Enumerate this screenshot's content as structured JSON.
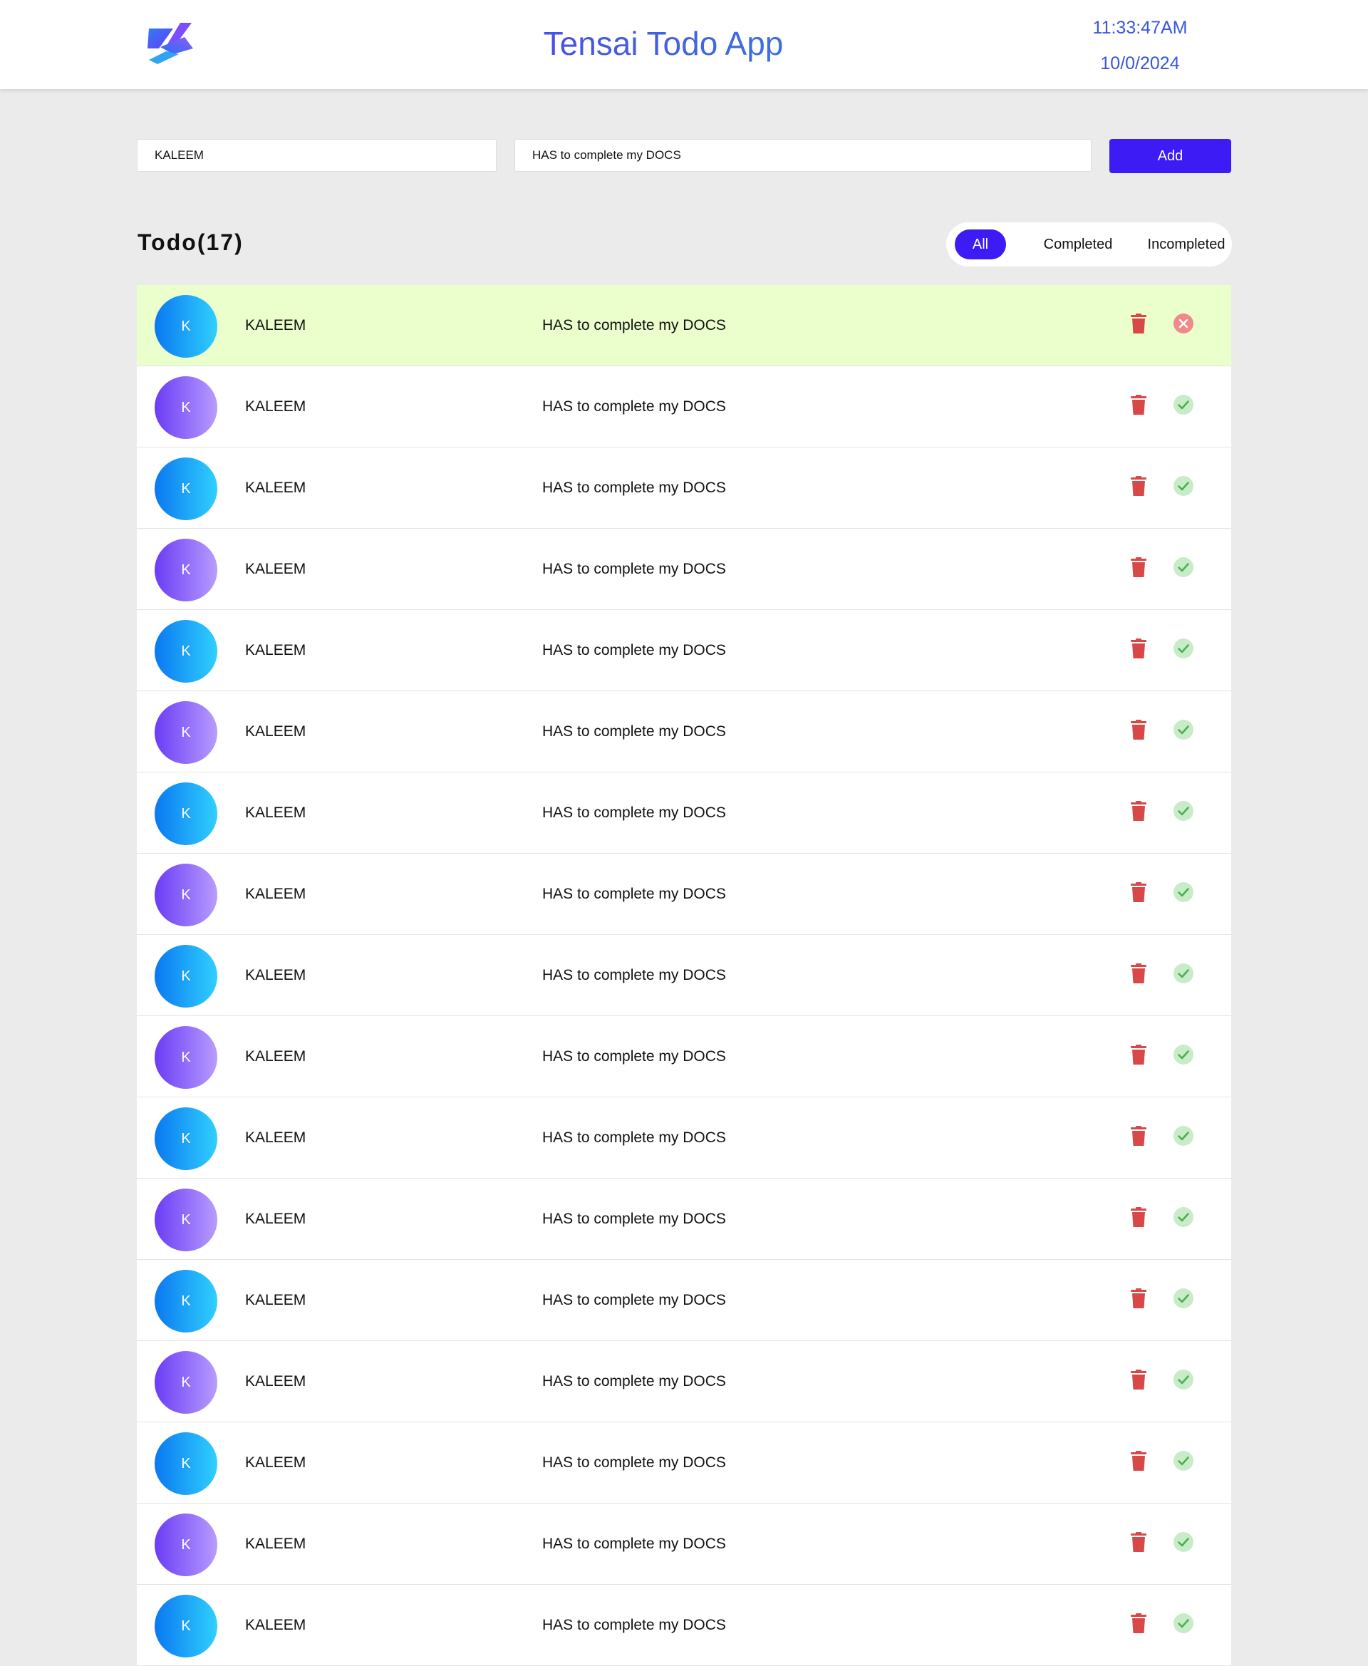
{
  "header": {
    "title": "Tensai Todo App",
    "time": "11:33:47AM",
    "date": "10/0/2024"
  },
  "form": {
    "name_value": "KALEEM",
    "task_value": "HAS to complete my DOCS",
    "add_label": "Add"
  },
  "list_header": {
    "title": "Todo(17)",
    "filters": [
      "All",
      "Completed",
      "Incompleted"
    ],
    "active_filter": "All"
  },
  "colors": {
    "accent": "#3c1bf5",
    "completed_row": "#eaffcc",
    "delete": "#d94848",
    "check": "#4caf50",
    "incomplete_icon": "#f08a8a"
  },
  "todos": [
    {
      "initial": "K",
      "name": "KALEEM",
      "task": "HAS to complete my DOCS",
      "avatar_color": "blue",
      "completed": true,
      "status_icon": "close-circle-icon"
    },
    {
      "initial": "K",
      "name": "KALEEM",
      "task": "HAS to complete my DOCS",
      "avatar_color": "purple",
      "completed": false,
      "status_icon": "check-circle-icon"
    },
    {
      "initial": "K",
      "name": "KALEEM",
      "task": "HAS to complete my DOCS",
      "avatar_color": "blue",
      "completed": false,
      "status_icon": "check-circle-icon"
    },
    {
      "initial": "K",
      "name": "KALEEM",
      "task": "HAS to complete my DOCS",
      "avatar_color": "purple",
      "completed": false,
      "status_icon": "check-circle-icon"
    },
    {
      "initial": "K",
      "name": "KALEEM",
      "task": "HAS to complete my DOCS",
      "avatar_color": "blue",
      "completed": false,
      "status_icon": "check-circle-icon"
    },
    {
      "initial": "K",
      "name": "KALEEM",
      "task": "HAS to complete my DOCS",
      "avatar_color": "purple",
      "completed": false,
      "status_icon": "check-circle-icon"
    },
    {
      "initial": "K",
      "name": "KALEEM",
      "task": "HAS to complete my DOCS",
      "avatar_color": "blue",
      "completed": false,
      "status_icon": "check-circle-icon"
    },
    {
      "initial": "K",
      "name": "KALEEM",
      "task": "HAS to complete my DOCS",
      "avatar_color": "purple",
      "completed": false,
      "status_icon": "check-circle-icon"
    },
    {
      "initial": "K",
      "name": "KALEEM",
      "task": "HAS to complete my DOCS",
      "avatar_color": "blue",
      "completed": false,
      "status_icon": "check-circle-icon"
    },
    {
      "initial": "K",
      "name": "KALEEM",
      "task": "HAS to complete my DOCS",
      "avatar_color": "purple",
      "completed": false,
      "status_icon": "check-circle-icon"
    },
    {
      "initial": "K",
      "name": "KALEEM",
      "task": "HAS to complete my DOCS",
      "avatar_color": "blue",
      "completed": false,
      "status_icon": "check-circle-icon"
    },
    {
      "initial": "K",
      "name": "KALEEM",
      "task": "HAS to complete my DOCS",
      "avatar_color": "purple",
      "completed": false,
      "status_icon": "check-circle-icon"
    },
    {
      "initial": "K",
      "name": "KALEEM",
      "task": "HAS to complete my DOCS",
      "avatar_color": "blue",
      "completed": false,
      "status_icon": "check-circle-icon"
    },
    {
      "initial": "K",
      "name": "KALEEM",
      "task": "HAS to complete my DOCS",
      "avatar_color": "purple",
      "completed": false,
      "status_icon": "check-circle-icon"
    },
    {
      "initial": "K",
      "name": "KALEEM",
      "task": "HAS to complete my DOCS",
      "avatar_color": "blue",
      "completed": false,
      "status_icon": "check-circle-icon"
    },
    {
      "initial": "K",
      "name": "KALEEM",
      "task": "HAS to complete my DOCS",
      "avatar_color": "purple",
      "completed": false,
      "status_icon": "check-circle-icon"
    },
    {
      "initial": "K",
      "name": "KALEEM",
      "task": "HAS to complete my DOCS",
      "avatar_color": "blue",
      "completed": false,
      "status_icon": "check-circle-icon"
    }
  ]
}
